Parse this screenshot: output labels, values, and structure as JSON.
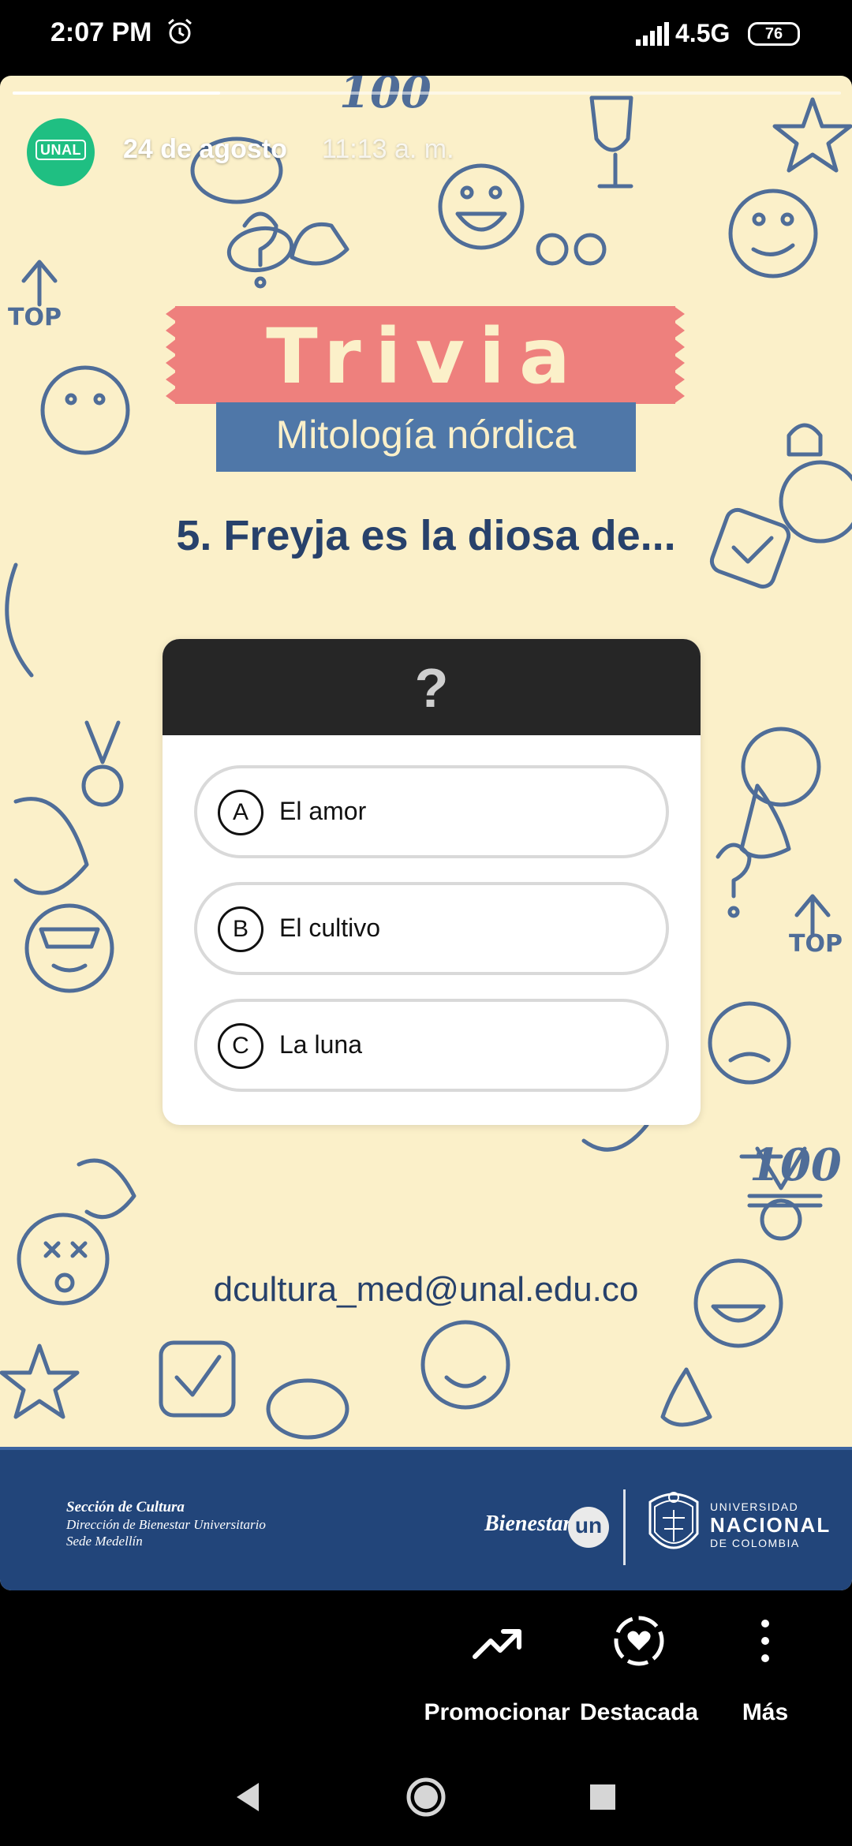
{
  "status_bar": {
    "time": "2:07 PM",
    "network": "4.5G",
    "battery": "76"
  },
  "story": {
    "progress_fraction": 0.25,
    "account": {
      "avatar_label": "UNAL"
    },
    "date": "24 de agosto",
    "time": "11:13 a. m."
  },
  "content": {
    "title": "Trivia",
    "subtitle": "Mitología nórdica",
    "question": "5. Freyja es la diosa de...",
    "quiz_header": "?",
    "options": [
      {
        "letter": "A",
        "label": "El amor"
      },
      {
        "letter": "B",
        "label": "El cultivo"
      },
      {
        "letter": "C",
        "label": "La luna"
      }
    ],
    "email": "dcultura_med@unal.edu.co"
  },
  "footer": {
    "section_title": "Sección de Cultura",
    "section_line_1": "Dirección de Bienestar Universitario",
    "section_line_2": "Sede Medellín",
    "bienestar": "Bienestar",
    "bienestar_badge": "un",
    "university_line_1": "UNIVERSIDAD",
    "university_line_2": "NACIONAL",
    "university_line_3": "DE COLOMBIA"
  },
  "actions": [
    {
      "label": "Promocionar",
      "icon": "trending-up-icon"
    },
    {
      "label": "Destacada",
      "icon": "heart-highlight-icon"
    },
    {
      "label": "Más",
      "icon": "more-vertical-icon"
    }
  ],
  "colors": {
    "background": "#fbf0c9",
    "title_banner": "#ee807d",
    "subtitle_banner": "#4f77a8",
    "question_text": "#27416b",
    "footer_band": "#22457a",
    "avatar": "#1fbf82"
  }
}
